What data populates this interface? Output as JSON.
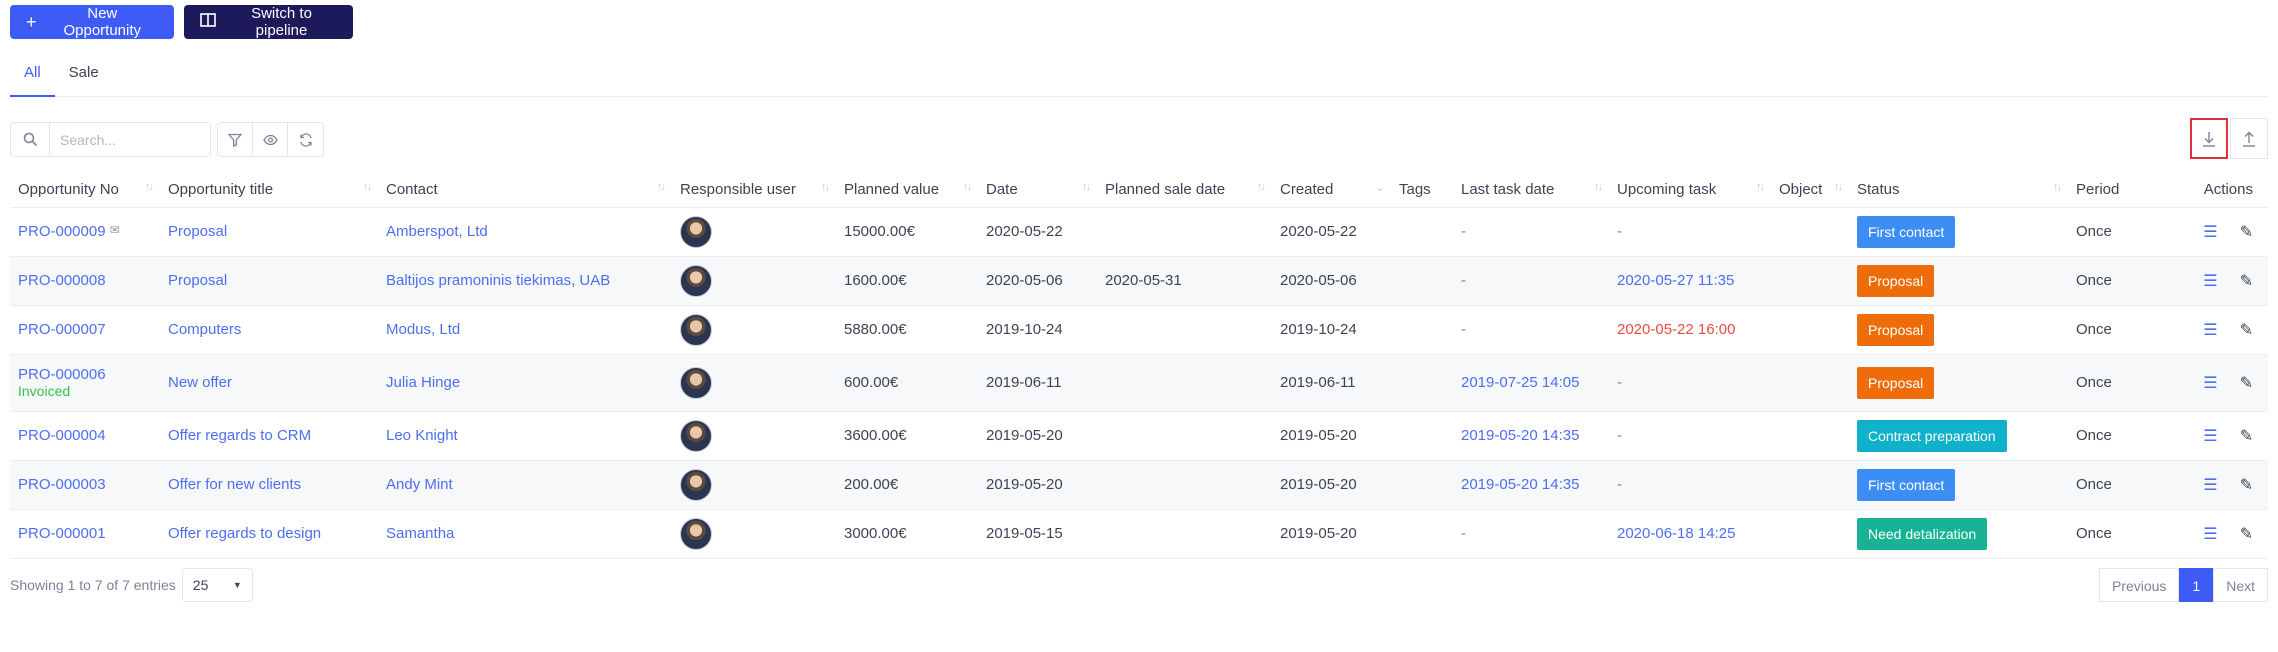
{
  "toolbar": {
    "new_label": "New Opportunity",
    "pipeline_label": "Switch to pipeline"
  },
  "tabs": [
    "All",
    "Sale"
  ],
  "search": {
    "placeholder": "Search..."
  },
  "columns": [
    "Opportunity No",
    "Opportunity title",
    "Contact",
    "Responsible user",
    "Planned value",
    "Date",
    "Planned sale date",
    "Created",
    "Tags",
    "Last task date",
    "Upcoming task",
    "Object",
    "Status",
    "Period",
    "Actions"
  ],
  "rows": [
    {
      "no": "PRO-000009",
      "note": "",
      "title": "Proposal",
      "contact": "Amberspot, Ltd",
      "value": "15000.00€",
      "date": "2020-05-22",
      "sale_date": "",
      "created": "2020-05-22",
      "last_task": "-",
      "upcoming": "-",
      "status": "First contact",
      "status_color": "#3c8ef5",
      "period": "Once"
    },
    {
      "no": "PRO-000008",
      "note": "",
      "title": "Proposal",
      "contact": "Baltijos pramoninis tiekimas, UAB",
      "value": "1600.00€",
      "date": "2020-05-06",
      "sale_date": "2020-05-31",
      "created": "2020-05-06",
      "last_task": "-",
      "upcoming": "2020-05-27 11:35",
      "status": "Proposal",
      "status_color": "#ef6c0b",
      "period": "Once"
    },
    {
      "no": "PRO-000007",
      "note": "",
      "title": "Computers",
      "contact": "Modus, Ltd",
      "value": "5880.00€",
      "date": "2019-10-24",
      "sale_date": "",
      "created": "2019-10-24",
      "last_task": "-",
      "upcoming": "2020-05-22 16:00",
      "status": "Proposal",
      "status_color": "#ef6c0b",
      "period": "Once"
    },
    {
      "no": "PRO-000006",
      "note": "Invoiced",
      "title": "New offer",
      "contact": "Julia Hinge",
      "value": "600.00€",
      "date": "2019-06-11",
      "sale_date": "",
      "created": "2019-06-11",
      "last_task": "2019-07-25 14:05",
      "upcoming": "-",
      "status": "Proposal",
      "status_color": "#ef6c0b",
      "period": "Once"
    },
    {
      "no": "PRO-000004",
      "note": "",
      "title": "Offer regards to CRM",
      "contact": "Leo Knight",
      "value": "3600.00€",
      "date": "2019-05-20",
      "sale_date": "",
      "created": "2019-05-20",
      "last_task": "2019-05-20 14:35",
      "upcoming": "-",
      "status": "Contract preparation",
      "status_color": "#0fb2ca",
      "period": "Once"
    },
    {
      "no": "PRO-000003",
      "note": "",
      "title": "Offer for new clients",
      "contact": "Andy Mint",
      "value": "200.00€",
      "date": "2019-05-20",
      "sale_date": "",
      "created": "2019-05-20",
      "last_task": "2019-05-20 14:35",
      "upcoming": "-",
      "status": "First contact",
      "status_color": "#3c8ef5",
      "period": "Once"
    },
    {
      "no": "PRO-000001",
      "note": "",
      "title": "Offer regards to design",
      "contact": "Samantha",
      "value": "3000.00€",
      "date": "2019-05-15",
      "sale_date": "",
      "created": "2019-05-20",
      "last_task": "-",
      "upcoming": "2020-06-18 14:25",
      "status": "Need detalization",
      "status_color": "#17b394",
      "period": "Once"
    }
  ],
  "footer": {
    "showing": "Showing 1 to 7 of 7 entries",
    "page_size": "25"
  },
  "pagination": {
    "previous": "Previous",
    "current": "1",
    "next": "Next"
  }
}
